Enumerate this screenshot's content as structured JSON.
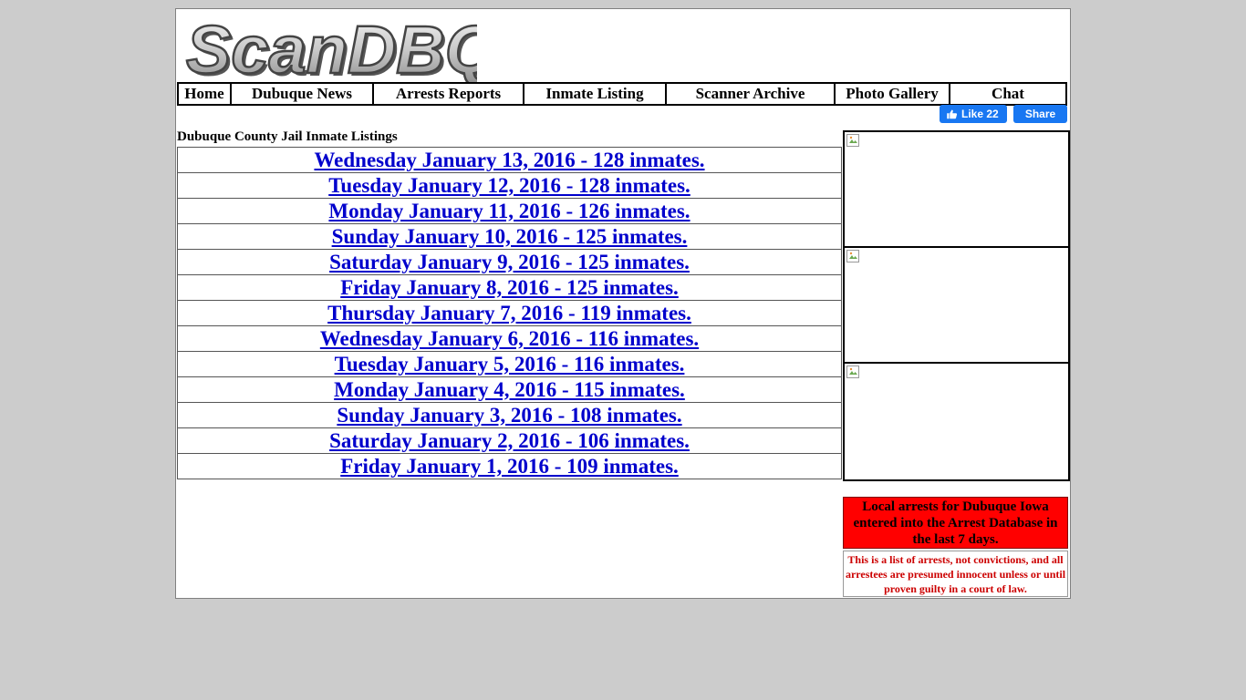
{
  "site": {
    "logo_text": "ScanDBQ"
  },
  "nav": {
    "items": [
      {
        "label": "Home"
      },
      {
        "label": "Dubuque News"
      },
      {
        "label": "Arrests Reports"
      },
      {
        "label": "Inmate Listing"
      },
      {
        "label": "Scanner Archive"
      },
      {
        "label": "Photo Gallery"
      },
      {
        "label": "Chat"
      }
    ]
  },
  "social": {
    "like_label": "Like 22",
    "share_label": "Share",
    "brand_color": "#1877f2"
  },
  "listing": {
    "title": "Dubuque County Jail Inmate Listings",
    "link_color": "#0000cc",
    "entries": [
      {
        "label": "Wednesday January 13, 2016 - 128 inmates."
      },
      {
        "label": "Tuesday January 12, 2016 - 128 inmates."
      },
      {
        "label": "Monday January 11, 2016 - 126 inmates."
      },
      {
        "label": "Sunday January 10, 2016 - 125 inmates."
      },
      {
        "label": "Saturday January 9, 2016 - 125 inmates."
      },
      {
        "label": "Friday January 8, 2016 - 125 inmates."
      },
      {
        "label": "Thursday January 7, 2016 - 119 inmates."
      },
      {
        "label": "Wednesday January 6, 2016 - 116 inmates."
      },
      {
        "label": "Tuesday January 5, 2016 - 116 inmates."
      },
      {
        "label": "Monday January 4, 2016 - 115 inmates."
      },
      {
        "label": "Sunday January 3, 2016 - 108 inmates."
      },
      {
        "label": "Saturday January 2, 2016 - 106 inmates."
      },
      {
        "label": "Friday January 1, 2016 - 109 inmates."
      }
    ]
  },
  "sidebar": {
    "ad_icon": "broken-image-icon",
    "arrests_box": {
      "text": "Local arrests for Dubuque Iowa entered into the Arrest Database in the last 7 days.",
      "bg_color": "#ff0000"
    },
    "disclaimer": {
      "text": "This is a list of arrests, not convictions, and all arrestees are presumed innocent unless or until proven guilty in a court of law.",
      "color": "#cc0000"
    }
  }
}
